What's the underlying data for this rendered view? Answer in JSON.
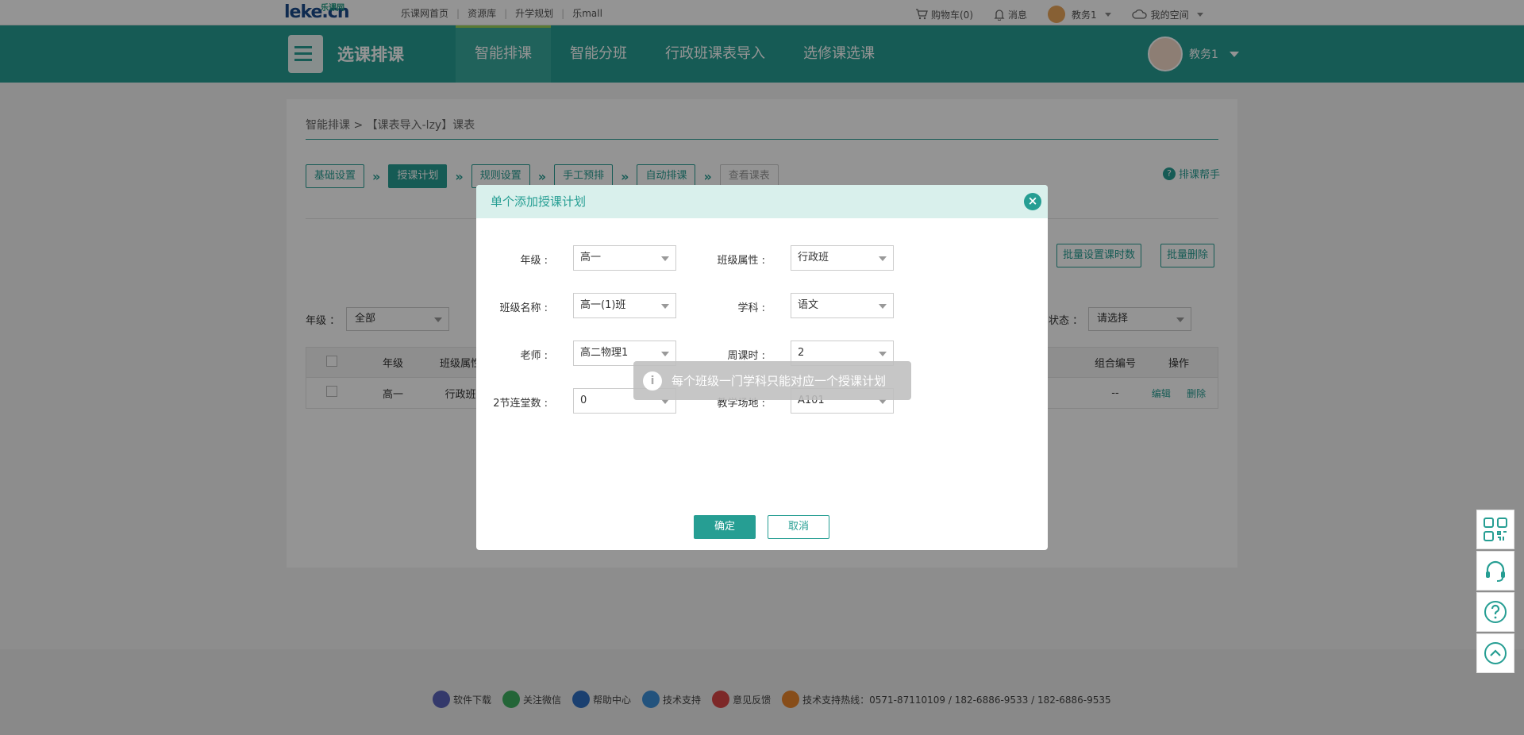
{
  "topbar": {
    "logo": "leke.cn",
    "logo_sub": "乐课网",
    "links": [
      "乐课网首页",
      "资源库",
      "升学规划",
      "乐mall"
    ],
    "cart": "购物车(0)",
    "messages": "消息",
    "user": "教务1",
    "space": "我的空间"
  },
  "header": {
    "title": "选课排课",
    "nav": [
      "智能排课",
      "智能分班",
      "行政班课表导入",
      "选修课选课"
    ],
    "active_nav": "智能排课",
    "user": "教务1"
  },
  "page": {
    "breadcrumb": "智能排课 > 【课表导入-lzy】课表",
    "steps": [
      "基础设置",
      "授课计划",
      "规则设置",
      "手工预排",
      "自动排课",
      "查看课表"
    ],
    "helper": "排课帮手",
    "batch_hours_button": "批量设置课时数",
    "batch_delete_button": "批量删除",
    "filters": {
      "grade_label": "年级 ：",
      "grade_value": "全部",
      "status_label": "状态 ：",
      "status_value": "请选择"
    },
    "table": {
      "headers": [
        "",
        "年级",
        "班级属性",
        "组合编号",
        "操作"
      ],
      "rows": [
        {
          "grade": "高一",
          "class_attr": "行政班",
          "group_no": "--",
          "edit": "编辑",
          "delete": "删除"
        }
      ]
    }
  },
  "modal": {
    "title": "单个添加授课计划",
    "fields": {
      "grade": {
        "label": "年级 :",
        "value": "高一"
      },
      "class_attr": {
        "label": "班级属性 :",
        "value": "行政班"
      },
      "class_name": {
        "label": "班级名称 :",
        "value": "高一(1)班"
      },
      "subject": {
        "label": "学科 :",
        "value": "语文"
      },
      "teacher": {
        "label": "老师 :",
        "value": "高二物理1"
      },
      "weekly_hours": {
        "label": "周课时 :",
        "value": "2"
      },
      "double_periods": {
        "label": "2节连堂数 :",
        "value": "0"
      },
      "venue": {
        "label": "教学场地 :",
        "value": "A101"
      }
    },
    "ok": "确定",
    "cancel": "取消"
  },
  "toast": {
    "message": "每个班级一门学科只能对应一个授课计划"
  },
  "footer": {
    "links": [
      "软件下载",
      "关注微信",
      "帮助中心",
      "技术支持",
      "意见反馈"
    ],
    "hotline": "技术支持热线：0571-87110109 / 182-6886-9533 / 182-6886-9535"
  },
  "colors": {
    "primary": "#269e93",
    "nav_active_bar": "#9bd35a",
    "modal_header_bg": "#d9f0ec"
  }
}
